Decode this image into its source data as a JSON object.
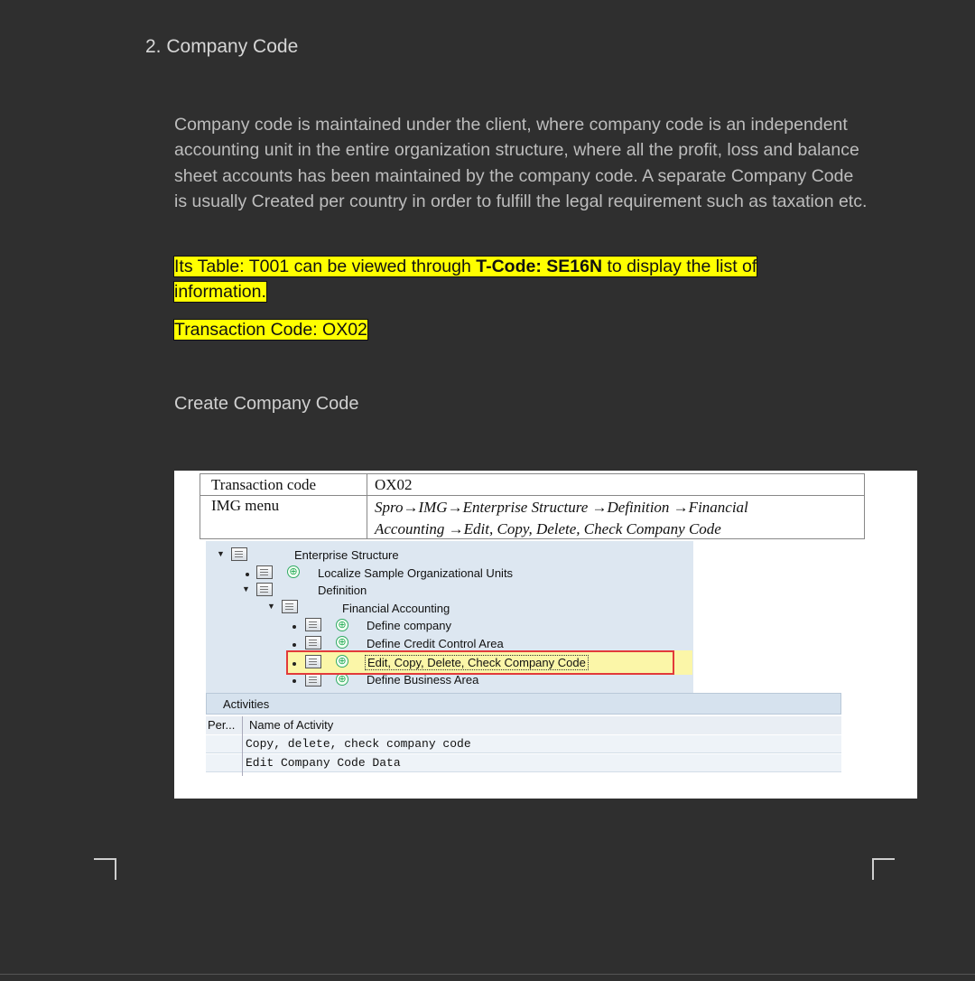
{
  "heading": "2. Company Code",
  "paragraph": "Company code is maintained under the client, where company code is an independent accounting unit in the entire organization structure, where all the profit, loss and balance sheet accounts has been maintained by the company code. A separate Company Code is usually Created per country in order to fulfill the legal requirement such as taxation etc.",
  "highlight": {
    "prefix": "Its Table: T001 can be viewed through ",
    "tcode": "T-Code: SE16N",
    "suffix": " to display the list of",
    "line2": "information.",
    "line3": "Transaction Code: OX02"
  },
  "subheading": "Create Company Code",
  "figure": {
    "table": {
      "r1c1": "Transaction code",
      "r1c2": "OX02",
      "r2c1": "IMG menu",
      "r2c2a": "Spro→IMG→Enterprise Structure →Definition →Financial",
      "r2c2b": "Accounting →Edit, Copy, Delete, Check Company Code"
    },
    "tree": {
      "enterprise": "Enterprise Structure",
      "localize": "Localize Sample Organizational Units",
      "definition": "Definition",
      "financial": "Financial Accounting",
      "define_company": "Define company",
      "define_credit": "Define Credit Control Area",
      "edit_copy": "Edit, Copy, Delete, Check Company Code",
      "define_business": "Define Business Area"
    },
    "activities": {
      "title": "Activities",
      "col1": "Per...",
      "col2": "Name of Activity",
      "rows": [
        "Copy, delete, check company code",
        "Edit Company Code Data"
      ]
    }
  },
  "colors": {
    "background": "#2f2f2f",
    "highlight": "#ffff00",
    "tree_bg": "#dde7f1",
    "red_box": "#e23a3a"
  }
}
